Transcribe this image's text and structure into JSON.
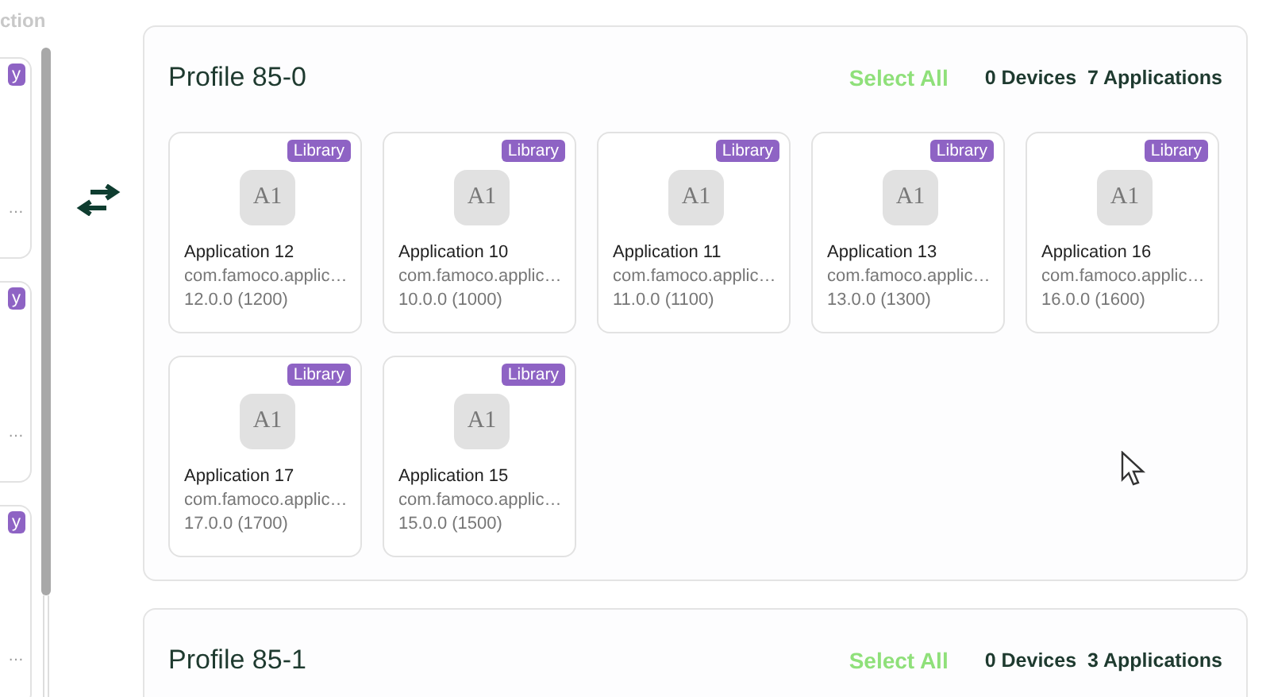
{
  "left_column": {
    "heading": "ction",
    "cards": [
      {
        "badge": "y",
        "text": "…"
      },
      {
        "badge": "y",
        "text": "…"
      },
      {
        "badge": "y",
        "text": "…"
      }
    ]
  },
  "profiles": [
    {
      "title": "Profile 85-0",
      "select_all": "Select All",
      "devices": "0 Devices",
      "applications": "7 Applications",
      "apps": [
        {
          "badge": "Library",
          "icon": "A1",
          "name": "Application 12",
          "package": "com.famoco.applic…",
          "version": "12.0.0 (1200)"
        },
        {
          "badge": "Library",
          "icon": "A1",
          "name": "Application 10",
          "package": "com.famoco.applic…",
          "version": "10.0.0 (1000)"
        },
        {
          "badge": "Library",
          "icon": "A1",
          "name": "Application 11",
          "package": "com.famoco.applic…",
          "version": "11.0.0 (1100)"
        },
        {
          "badge": "Library",
          "icon": "A1",
          "name": "Application 13",
          "package": "com.famoco.applic…",
          "version": "13.0.0 (1300)"
        },
        {
          "badge": "Library",
          "icon": "A1",
          "name": "Application 16",
          "package": "com.famoco.applic…",
          "version": "16.0.0 (1600)"
        },
        {
          "badge": "Library",
          "icon": "A1",
          "name": "Application 17",
          "package": "com.famoco.applic…",
          "version": "17.0.0 (1700)"
        },
        {
          "badge": "Library",
          "icon": "A1",
          "name": "Application 15",
          "package": "com.famoco.applic…",
          "version": "15.0.0 (1500)"
        }
      ]
    },
    {
      "title": "Profile 85-1",
      "select_all": "Select All",
      "devices": "0 Devices",
      "applications": "3 Applications"
    }
  ]
}
